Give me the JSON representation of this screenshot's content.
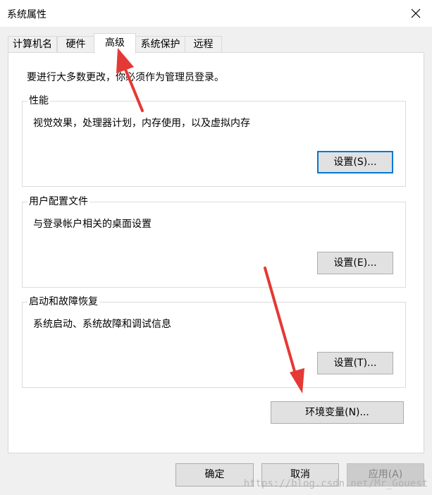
{
  "window": {
    "title": "系统属性"
  },
  "tabs": [
    {
      "label": "计算机名",
      "active": false
    },
    {
      "label": "硬件",
      "active": false
    },
    {
      "label": "高级",
      "active": true
    },
    {
      "label": "系统保护",
      "active": false
    },
    {
      "label": "远程",
      "active": false
    }
  ],
  "advanced": {
    "admin_note": "要进行大多数更改，你必须作为管理员登录。",
    "performance": {
      "title": "性能",
      "description": "视觉效果，处理器计划，内存使用，以及虚拟内存",
      "button": "设置(S)..."
    },
    "user_profiles": {
      "title": "用户配置文件",
      "description": "与登录帐户相关的桌面设置",
      "button": "设置(E)..."
    },
    "startup_recovery": {
      "title": "启动和故障恢复",
      "description": "系统启动、系统故障和调试信息",
      "button": "设置(T)..."
    },
    "env_button": "环境变量(N)..."
  },
  "footer": {
    "ok": "确定",
    "cancel": "取消",
    "apply": "应用(A)"
  },
  "watermark": "https://blog.csdn.net/Mr_Gouest",
  "colors": {
    "focus_border": "#0078d7",
    "annotation_arrow": "#e53935"
  },
  "icons": {
    "close": "close-icon"
  }
}
